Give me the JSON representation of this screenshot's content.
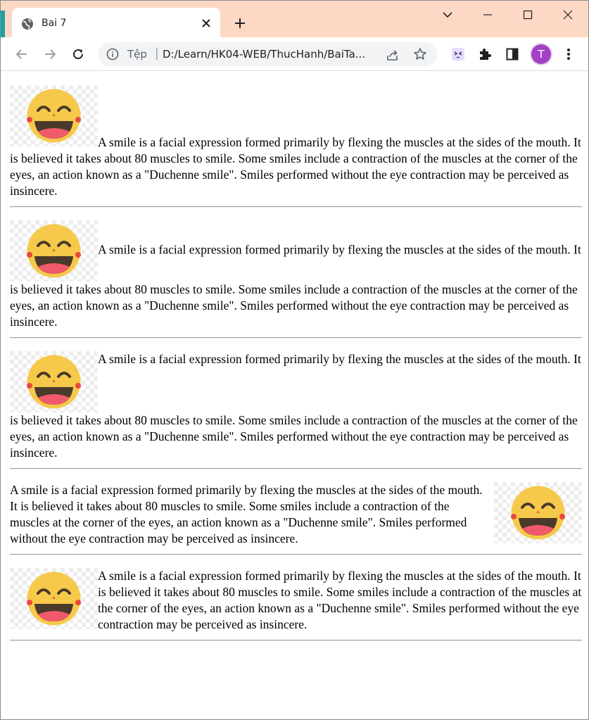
{
  "browser": {
    "tab_title": "Bai 7",
    "address_scheme": "Tệp",
    "address_url": "D:/Learn/HK04-WEB/ThucHanh/BaiTa...",
    "profile_initial": "T",
    "colors": {
      "tab_strip": "#fdd9c5",
      "avatar": "#a142c6"
    }
  },
  "page": {
    "paragraph_text": "A smile is a facial expression formed primarily by flexing the muscles at the sides of the mouth. It is believed it takes about 80 muscles to smile. Some smiles include a contraction of the muscles at the corner of the eyes, an action known as a \"Duchenne smile\". Smiles performed without the eye contraction may be perceived as insincere.",
    "sections": [
      {
        "image_alignment": "baseline",
        "image_icon": "laughing-face-icon"
      },
      {
        "image_alignment": "middle",
        "image_icon": "laughing-face-icon"
      },
      {
        "image_alignment": "top",
        "image_icon": "laughing-face-icon"
      },
      {
        "image_alignment": "float-right",
        "image_icon": "laughing-face-icon"
      },
      {
        "image_alignment": "float-left",
        "image_icon": "laughing-face-icon"
      }
    ]
  }
}
